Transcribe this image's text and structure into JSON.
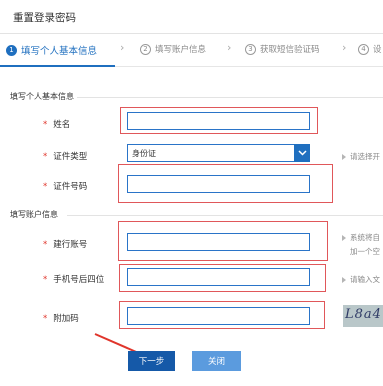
{
  "header": {
    "title": "重置登录密码"
  },
  "steps": [
    {
      "num": "1",
      "label": "填写个人基本信息"
    },
    {
      "num": "2",
      "label": "填写账户信息"
    },
    {
      "num": "3",
      "label": "获取短信验证码"
    },
    {
      "num": "4",
      "label": "设"
    }
  ],
  "section_personal": {
    "title": "填写个人基本信息",
    "name_label": "姓名",
    "id_type_label": "证件类型",
    "id_type_value": "身份证",
    "id_type_hint": "请选择开",
    "id_number_label": "证件号码"
  },
  "section_account": {
    "title": "填写账户信息",
    "account_label": "建行账号",
    "account_hint_1": "系统将自",
    "account_hint_2": "加一个空",
    "phone_label": "手机号后四位",
    "phone_hint": "请输入文",
    "captcha_label": "附加码",
    "captcha_text": "L8a4"
  },
  "actions": {
    "next_label": "下一步",
    "close_label": "关闭"
  },
  "required_mark": "*"
}
